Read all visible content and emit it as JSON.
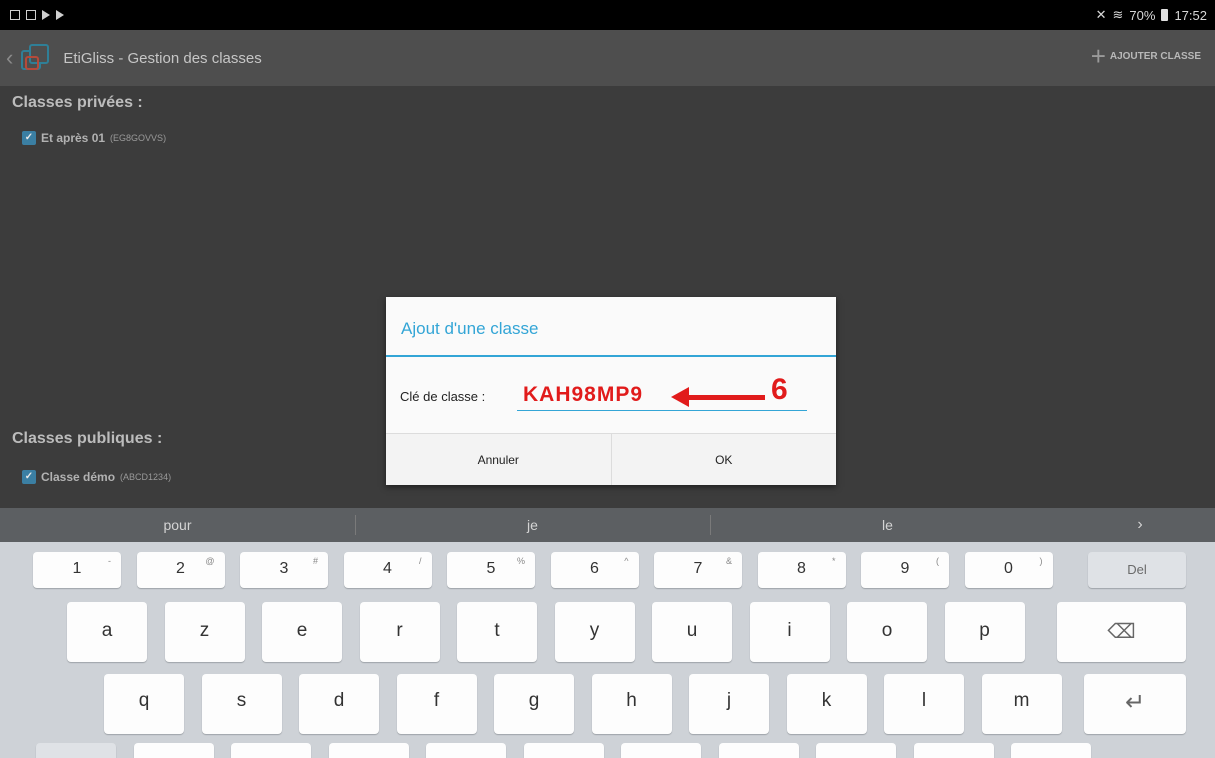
{
  "status_bar": {
    "battery": "70%",
    "time": "17:52"
  },
  "action_bar": {
    "app_title": "EtiGliss - Gestion des classes",
    "add_class_label": "AJOUTER CLASSE"
  },
  "private_section": {
    "title": "Classes privées :",
    "items": [
      {
        "name": "Et après 01",
        "code": "(EG8GOVVS)",
        "checked": true
      }
    ]
  },
  "public_section": {
    "title": "Classes publiques :",
    "items": [
      {
        "name": "Classe démo",
        "code": "(ABCD1234)",
        "checked": true
      }
    ]
  },
  "dialog": {
    "title": "Ajout d'une classe",
    "field_label": "Clé de classe :",
    "field_value": "KAH98MP9",
    "annotation_number": "6",
    "cancel_label": "Annuler",
    "ok_label": "OK"
  },
  "keyboard": {
    "suggestions": [
      "pour",
      "je",
      "le"
    ],
    "suggestion_more": "›",
    "row_numbers": [
      {
        "k": "1",
        "s": "-"
      },
      {
        "k": "2",
        "s": "@"
      },
      {
        "k": "3",
        "s": "#"
      },
      {
        "k": "4",
        "s": "/"
      },
      {
        "k": "5",
        "s": "%"
      },
      {
        "k": "6",
        "s": "^"
      },
      {
        "k": "7",
        "s": "&"
      },
      {
        "k": "8",
        "s": "*"
      },
      {
        "k": "9",
        "s": "("
      },
      {
        "k": "0",
        "s": ")"
      }
    ],
    "del_label": "Del",
    "row_top": [
      "a",
      "z",
      "e",
      "r",
      "t",
      "y",
      "u",
      "i",
      "o",
      "p"
    ],
    "row_mid": [
      "q",
      "s",
      "d",
      "f",
      "g",
      "h",
      "j",
      "k",
      "l",
      "m"
    ],
    "backspace_icon": "backspace-icon",
    "enter_icon": "enter-icon"
  }
}
